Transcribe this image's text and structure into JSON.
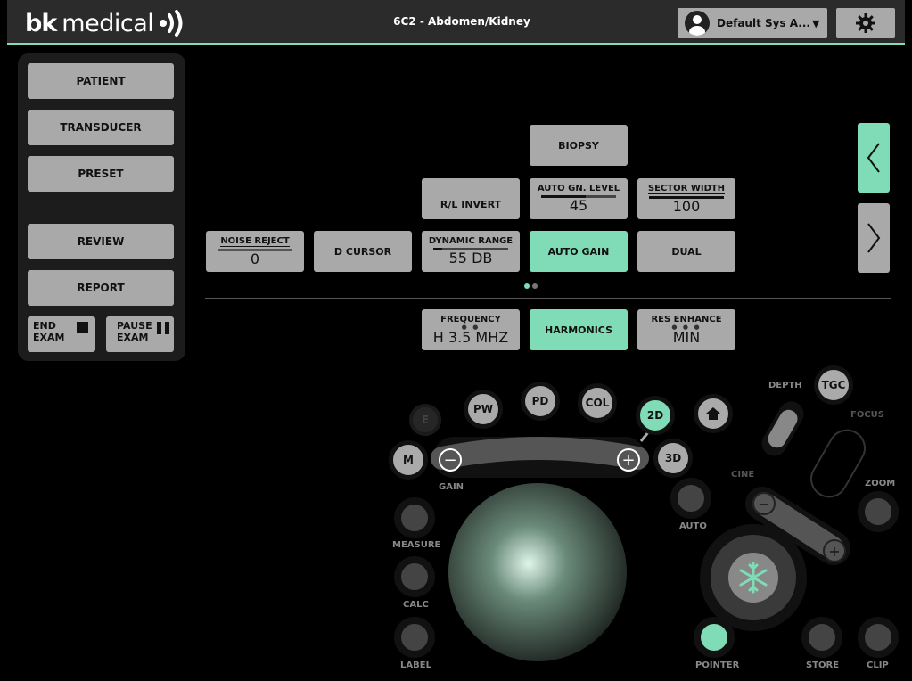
{
  "brand": {
    "bk": "bk",
    "medical": "medical"
  },
  "header": {
    "title": "6C2 - Abdomen/Kidney",
    "user": "Default Sys A...",
    "user_caret": "▼"
  },
  "left_panel": {
    "patient": "PATIENT",
    "transducer": "TRANSDUCER",
    "preset": "PRESET",
    "review": "REVIEW",
    "report": "REPORT",
    "end_exam": "END\nEXAM",
    "end_exam_l1": "END",
    "end_exam_l2": "EXAM",
    "pause_exam_l1": "PAUSE",
    "pause_exam_l2": "EXAM"
  },
  "main_panel": {
    "biopsy": "BIOPSY",
    "rl_invert": "R/L INVERT",
    "auto_gn_level": {
      "label": "AUTO GN. LEVEL",
      "value": "45",
      "fill": 0.6
    },
    "sector_width": {
      "label": "SECTOR WIDTH",
      "value": "100"
    },
    "noise_reject": {
      "label": "NOISE REJECT",
      "value": "0"
    },
    "d_cursor": "D CURSOR",
    "dynamic_range": {
      "label": "DYNAMIC RANGE",
      "value": "55 DB",
      "fill": 0.12
    },
    "auto_gain": "AUTO GAIN",
    "dual": "DUAL",
    "frequency": {
      "label": "FREQUENCY",
      "value": "H 3.5 MHZ"
    },
    "harmonics": "HARMONICS",
    "res_enhance": {
      "label": "RES ENHANCE",
      "value": "MIN"
    }
  },
  "surface": {
    "e": "E",
    "pw": "PW",
    "pd": "PD",
    "col": "COL",
    "two_d": "2D",
    "three_d": "3D",
    "m": "M",
    "tgc": "TGC",
    "depth": "DEPTH",
    "focus": "FOCUS",
    "gain": "GAIN",
    "cine": "CINE",
    "zoom": "ZOOM",
    "auto": "AUTO",
    "measure": "MEASURE",
    "calc": "CALC",
    "label": "LABEL",
    "pointer": "POINTER",
    "store": "STORE",
    "clip": "CLIP",
    "minus": "−",
    "plus": "+"
  },
  "colors": {
    "accent": "#7fdcb6",
    "button": "#a9a9a9",
    "panel": "#1c1c1c"
  },
  "icons": [
    "sound-waves-icon",
    "user-avatar-icon",
    "gear-icon",
    "chevron-left-icon",
    "chevron-right-icon",
    "home-icon",
    "snowflake-icon"
  ]
}
